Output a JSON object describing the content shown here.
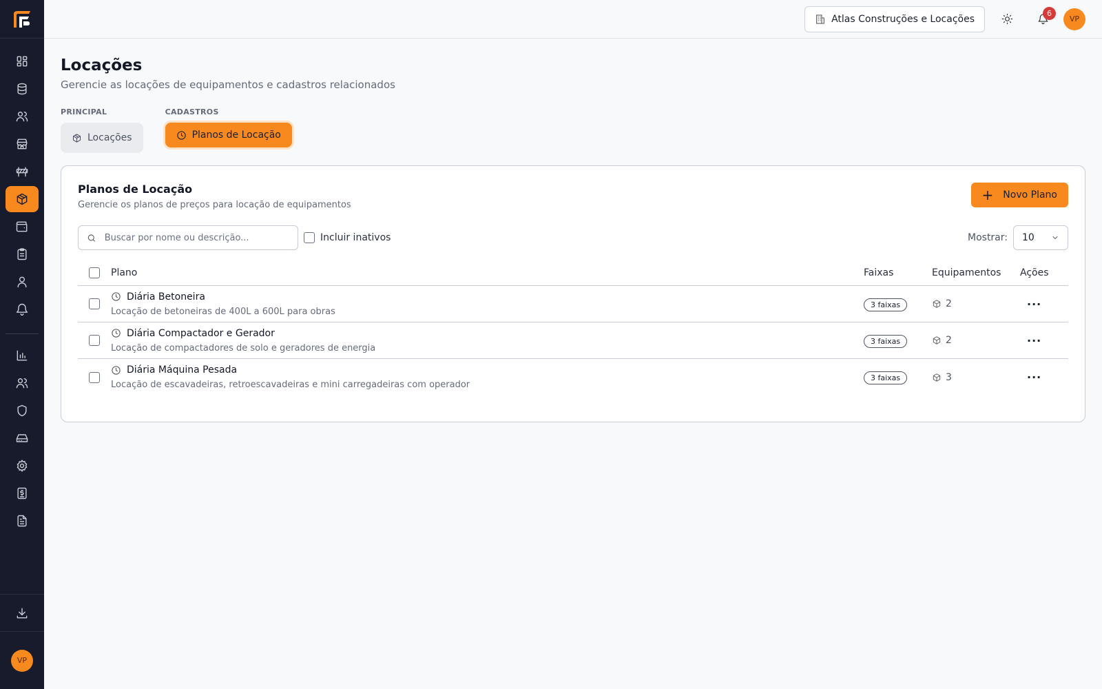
{
  "topbar": {
    "company": "Atlas Construções e Locações",
    "notifications_count": "6",
    "avatar_initials": "VP"
  },
  "page": {
    "title": "Locações",
    "subtitle": "Gerencie as locações de equipamentos e cadastros relacionados"
  },
  "tab_groups": [
    {
      "label": "PRINCIPAL",
      "tab": "Locações"
    },
    {
      "label": "CADASTROS",
      "tab": "Planos de Locação"
    }
  ],
  "card": {
    "title": "Planos de Locação",
    "subtitle": "Gerencie os planos de preços para locação de equipamentos",
    "new_button": "Novo Plano",
    "search_placeholder": "Buscar por nome ou descrição...",
    "include_inactive": "Incluir inativos",
    "show_label": "Mostrar:",
    "show_value": "10"
  },
  "table": {
    "headers": {
      "plan": "Plano",
      "faixas": "Faixas",
      "equip": "Equipamentos",
      "acoes": "Ações"
    },
    "rows": [
      {
        "name": "Diária Betoneira",
        "desc": "Locação de betoneiras de 400L a 600L para obras",
        "faixas": "3 faixas",
        "equip": "2"
      },
      {
        "name": "Diária Compactador e Gerador",
        "desc": "Locação de compactadores de solo e geradores de energia",
        "faixas": "3 faixas",
        "equip": "2"
      },
      {
        "name": "Diária Máquina Pesada",
        "desc": "Locação de escavadeiras, retroescavadeiras e mini carregadeiras com operador",
        "faixas": "3 faixas",
        "equip": "3"
      }
    ]
  },
  "sidebar": {
    "avatar_initials": "VP"
  },
  "colors": {
    "accent": "#f7891f",
    "sidebar_bg": "#171b2b",
    "badge": "#d63b3b"
  }
}
